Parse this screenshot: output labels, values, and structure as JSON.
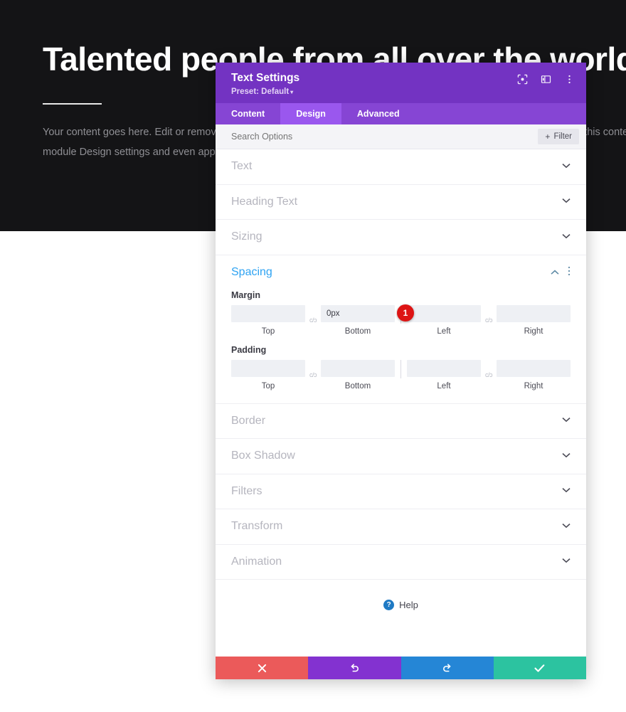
{
  "background_page": {
    "heading": "Talented people from all over the world",
    "paragraph_lines": [
      "Your content goes here. Edit or remove this text inline or in the module Content tab. You can also style every aspect of this content in the",
      "module Design settings and even apply custom CSS to this text in the module Advanced settings."
    ]
  },
  "modal": {
    "title": "Text Settings",
    "preset_label": "Preset: Default",
    "preset_caret": "▾",
    "header_icons": [
      {
        "name": "focus-icon",
        "title": "Focus"
      },
      {
        "name": "layout-toggle-icon",
        "title": "Layout"
      },
      {
        "name": "more-options-icon",
        "title": "More"
      }
    ],
    "tabs": [
      {
        "label": "Content",
        "active": false
      },
      {
        "label": "Design",
        "active": true
      },
      {
        "label": "Advanced",
        "active": false
      }
    ],
    "search": {
      "placeholder": "Search Options",
      "value": ""
    },
    "filter_button": {
      "plus": "+",
      "label": "Filter"
    },
    "sections_before": [
      {
        "label": "Text"
      },
      {
        "label": "Heading Text"
      },
      {
        "label": "Sizing"
      }
    ],
    "spacing": {
      "title": "Spacing",
      "collapse_icon": "chevron-up",
      "menu_icon": "kebab",
      "margin": {
        "label": "Margin",
        "link_glyph": "c/ɔ",
        "fields": [
          {
            "caption": "Top",
            "value": "",
            "placeholder": ""
          },
          {
            "caption": "Bottom",
            "value": "0px",
            "placeholder": ""
          },
          {
            "caption": "Left",
            "value": "",
            "placeholder": ""
          },
          {
            "caption": "Right",
            "value": "",
            "placeholder": ""
          }
        ],
        "badge": "1"
      },
      "padding": {
        "label": "Padding",
        "link_glyph": "c/ɔ",
        "fields": [
          {
            "caption": "Top",
            "value": "",
            "placeholder": ""
          },
          {
            "caption": "Bottom",
            "value": "",
            "placeholder": ""
          },
          {
            "caption": "Left",
            "value": "",
            "placeholder": ""
          },
          {
            "caption": "Right",
            "value": "",
            "placeholder": ""
          }
        ]
      }
    },
    "sections_after": [
      {
        "label": "Border"
      },
      {
        "label": "Box Shadow"
      },
      {
        "label": "Filters"
      },
      {
        "label": "Transform"
      },
      {
        "label": "Animation"
      }
    ],
    "help": {
      "icon_glyph": "?",
      "label": "Help"
    },
    "footer_buttons": [
      {
        "name": "discard-button",
        "icon": "cross",
        "color": "#eb5a5a"
      },
      {
        "name": "undo-button",
        "icon": "undo",
        "color": "#8332d0"
      },
      {
        "name": "redo-button",
        "icon": "redo",
        "color": "#2586d6"
      },
      {
        "name": "save-button",
        "icon": "checkmark",
        "color": "#2cc3a0"
      }
    ]
  },
  "colors": {
    "header_purple": "#7333c2",
    "tabbar_purple": "#8645d4",
    "tab_active_purple": "#9a57ee",
    "accent_blue": "#2ea3f2",
    "badge_red": "#dd1414",
    "hero_dark": "#141416"
  }
}
